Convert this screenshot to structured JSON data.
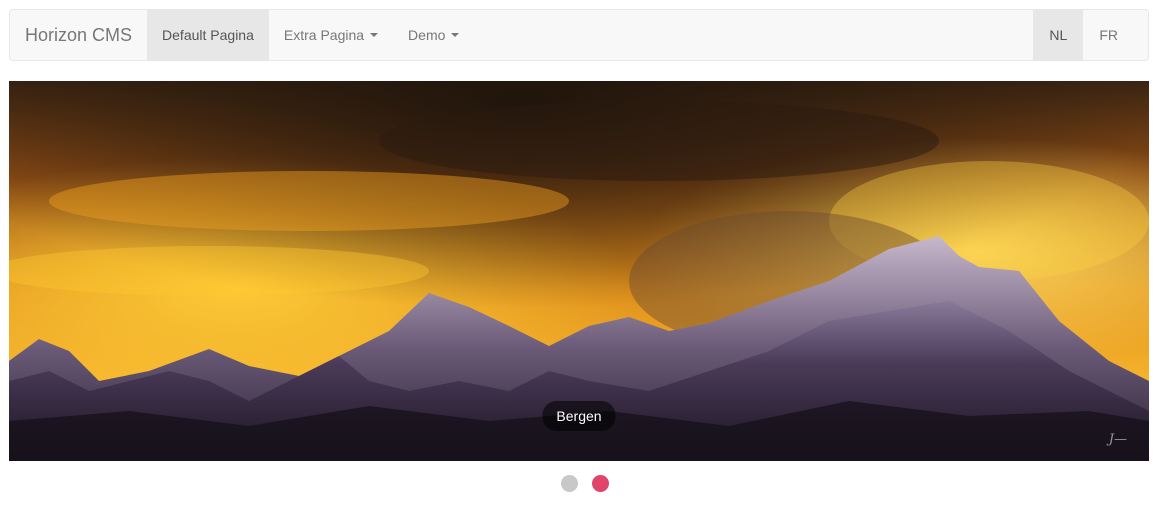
{
  "navbar": {
    "brand": "Horizon CMS",
    "items": [
      {
        "label": "Default Pagina",
        "active": true,
        "dropdown": false
      },
      {
        "label": "Extra Pagina",
        "active": false,
        "dropdown": true
      },
      {
        "label": "Demo",
        "active": false,
        "dropdown": true
      }
    ],
    "languages": [
      {
        "label": "NL",
        "active": true
      },
      {
        "label": "FR",
        "active": false
      }
    ]
  },
  "carousel": {
    "caption": "Bergen",
    "watermark": "J—",
    "slides_total": 2,
    "active_slide": 2
  },
  "colors": {
    "indicator_inactive": "#c8c8c8",
    "indicator_active": "#e0446b"
  }
}
